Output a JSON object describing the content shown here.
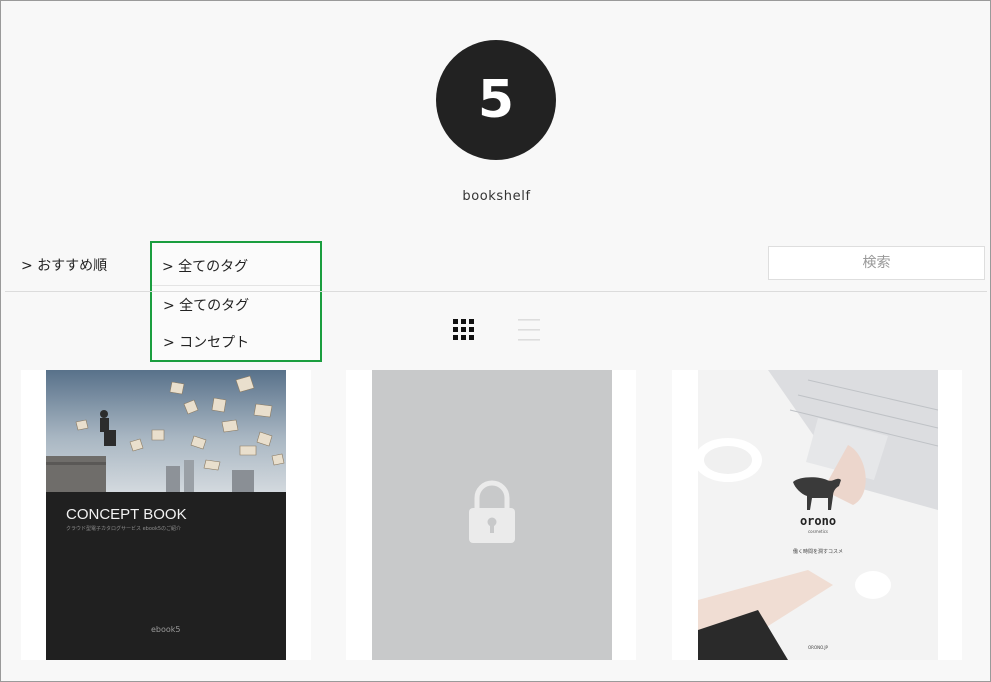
{
  "header": {
    "logo_text": "5",
    "site_name": "bookshelf"
  },
  "filters": {
    "sort_label": "> おすすめ順",
    "tag_dropdown": {
      "selected": "> 全てのタグ",
      "options": [
        "> 全てのタグ",
        "> コンセプト"
      ],
      "highlight_color": "#1a9e3f"
    },
    "search_placeholder": "検索"
  },
  "view_toggle": {
    "grid_icon": "grid-icon",
    "list_icon": "list-icon",
    "active": "grid"
  },
  "books": [
    {
      "title": "CONCEPT BOOK",
      "subtitle": "クラウド型電子カタログサービス ebook5のご紹介",
      "brand": "ebook5",
      "locked": false
    },
    {
      "locked": true,
      "icon": "lock-icon"
    },
    {
      "title": "orono",
      "subtitle": "cosmetics",
      "tagline": "働く時間を潤すコスメ",
      "footer": "ORONO.JP",
      "locked": false
    }
  ]
}
